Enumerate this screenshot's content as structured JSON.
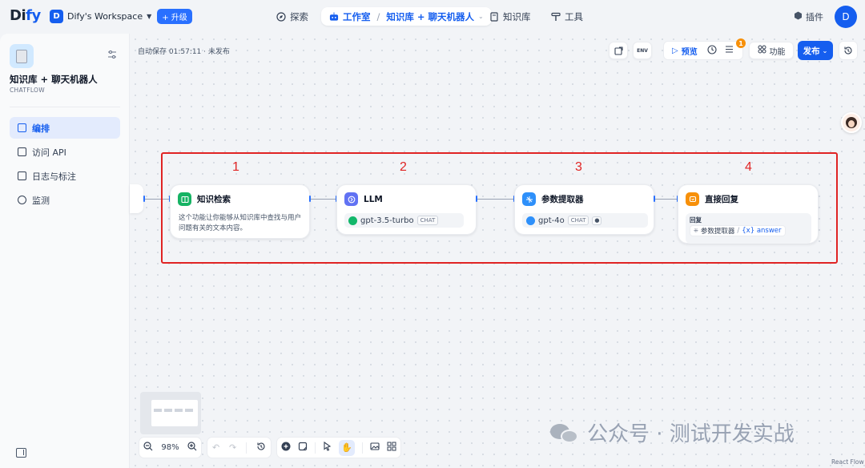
{
  "topbar": {
    "logo_main": "Di",
    "logo_accent": "fy",
    "workspace_initial": "D",
    "workspace_name": "Dify's Workspace",
    "upgrade_label": "+ 升级",
    "nav": {
      "explore": "探索",
      "studio": "工作室",
      "app_name": "知识库 + 聊天机器人",
      "knowledge": "知识库",
      "tools": "工具"
    },
    "plugins_label": "插件",
    "user_initial": "D"
  },
  "sidebar": {
    "app_name": "知识库 + 聊天机器人",
    "app_mode": "CHATFLOW",
    "items": [
      {
        "label": "编排",
        "active": true
      },
      {
        "label": "访问 API",
        "active": false
      },
      {
        "label": "日志与标注",
        "active": false
      },
      {
        "label": "监测",
        "active": false
      }
    ]
  },
  "canvas": {
    "autosave_text": "自动保存 01:57:11 · 未发布",
    "toolbar": {
      "env_label": "ENV",
      "preview_label": "预览",
      "checklist_badge": "1",
      "features_label": "功能",
      "publish_label": "发布"
    },
    "step_numbers": [
      "1",
      "2",
      "3",
      "4"
    ],
    "nodes": {
      "knowledge": {
        "title": "知识检索",
        "description": "这个功能让你能够从知识库中查找与用户问题有关的文本内容。"
      },
      "llm": {
        "title": "LLM",
        "model": "gpt-3.5-turbo",
        "model_tag": "CHAT"
      },
      "extractor": {
        "title": "参数提取器",
        "model": "gpt-4o",
        "model_tag": "CHAT"
      },
      "answer": {
        "title": "直接回复",
        "answer_label": "回复",
        "source_node": "参数提取器",
        "variable": "{x} answer"
      }
    },
    "zoom": "98%",
    "react_flow_label": "React Flow"
  },
  "watermark": {
    "text": "公众号 · 测试开发实战"
  },
  "colors": {
    "primary": "#155eef",
    "highlight_red": "#e02424",
    "knowledge_icon": "#16b364",
    "llm_icon": "#6172f3",
    "extractor_icon": "#2e90fa",
    "answer_icon": "#f79009",
    "gpt35_icon": "#12b76a",
    "gpt4o_icon": "#2e90fa"
  }
}
